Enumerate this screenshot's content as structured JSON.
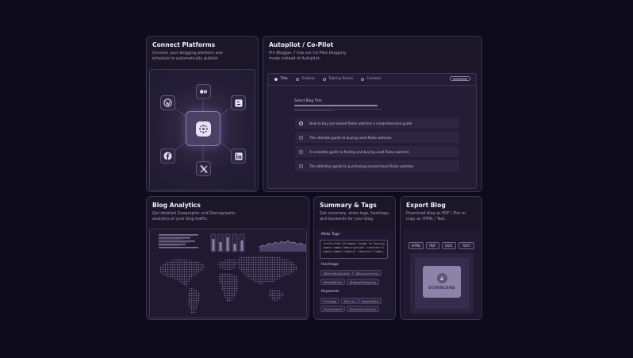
{
  "connect": {
    "title": "Connect Platforms",
    "desc_line1": "Connect your blogging platform and",
    "desc_line2": "schedule to automatically publish.",
    "platforms": [
      "wordpress-icon",
      "medium-icon",
      "blogger-icon",
      "facebook-icon",
      "x-icon",
      "linkedin-icon"
    ]
  },
  "autopilot": {
    "title": "Autopilot / Co-Pilot",
    "desc_line1": "Pro Blogger..? Use our Co-Pilot blogging",
    "desc_line2": "mode instead of Autopilot.",
    "tabs": [
      {
        "label": "Title"
      },
      {
        "label": "Outline"
      },
      {
        "label": "Talking Points"
      },
      {
        "label": "Content"
      }
    ],
    "select_label": "Select Blog Title",
    "options": [
      {
        "label": "How to buy pre-owned Rolex watches a comprehensive guide"
      },
      {
        "label": "The ultimate guide to buying used Rolex watches"
      },
      {
        "label": "A complete guide to finding and buying used Rolex watches"
      },
      {
        "label": "The definitive guide to purchasing second-hand Rolex watches"
      }
    ]
  },
  "analytics": {
    "title": "Blog Analytics",
    "desc_line1": "Get detailed Geographic and Demographic",
    "desc_line2": "analytics of your blog traffic."
  },
  "summary": {
    "title": "Summary & Tags",
    "desc_line1": "Get summary, meta tags, hashtags,",
    "desc_line2": "and keywords for your blog.",
    "meta_label": "Meta Tags",
    "meta_lines": [
      "<title>The Ultimate Guide to Buying",
      "<meta name=\"description\" content=\"L",
      "<meta name=\"robots\" content=\"index,"
    ],
    "hashtags_label": "Hashtags",
    "hashtags": [
      "#RolexBuyGuide",
      "#Swisschrono",
      "#UsedRolex",
      "#HappyShopping"
    ],
    "keywords_label": "Keywords",
    "keywords": [
      "Vintage",
      "Rarity",
      "Reputable",
      "Investment",
      "Authentication"
    ]
  },
  "export": {
    "title": "Export Blog",
    "desc_line1": "Download blog as PDF / Doc or",
    "desc_line2": "copy as HTML / Text.",
    "formats": [
      "HTML",
      "PDF",
      "DOC",
      "TEXT"
    ],
    "download_label": "DOWNLOAD"
  }
}
